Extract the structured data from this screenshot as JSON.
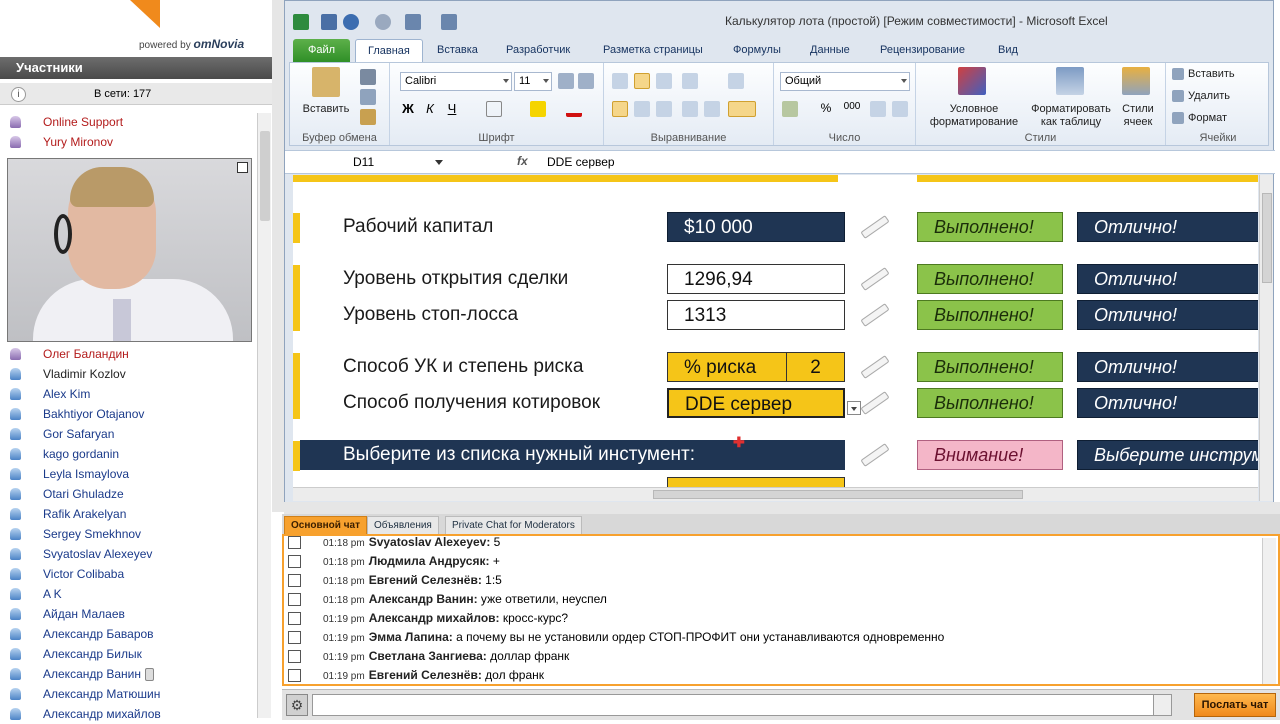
{
  "brand": {
    "powered": "powered by",
    "name": "omNovia"
  },
  "participants": {
    "header": "Участники",
    "online_label": "В сети: 177",
    "top_items": [
      "Online Support",
      "Yury Mironov"
    ],
    "items": [
      "Олег Баландин",
      "Vladimir Kozlov",
      "Alex Kim",
      "Bakhtiyor Otajanov",
      "Gor Safaryan",
      "kago gordanin",
      "Leyla Ismaylova",
      "Otari Ghuladze",
      "Rafik Arakelyan",
      "Sergey Smekhnov",
      "Svyatoslav Alexeyev",
      "Victor Colibaba",
      "A K",
      "Айдан Малаев",
      "Александр Баваров",
      "Александр Билык",
      "Александр Ванин",
      "Александр Матюшин",
      "Александр михайлов"
    ]
  },
  "excel": {
    "title": "Калькулятор лота (простой)  [Режим совместимости]  -  Microsoft Excel",
    "tabs": [
      "Файл",
      "Главная",
      "Вставка",
      "Разработчик",
      "Разметка страницы",
      "Формулы",
      "Данные",
      "Рецензирование",
      "Вид"
    ],
    "ribbon": {
      "paste": "Вставить",
      "clipboard": "Буфер обмена",
      "font_name": "Calibri",
      "font_size": "11",
      "font_group": "Шрифт",
      "align_group": "Выравнивание",
      "number_format": "Общий",
      "number_group": "Число",
      "cond_format": "Условное форматирование",
      "format_table": "Форматировать как таблицу",
      "cell_styles": "Стили ячеек",
      "styles_group": "Стили",
      "insert": "Вставить",
      "delete": "Удалить",
      "format": "Формат",
      "cells_group": "Ячейки"
    },
    "name_box": "D11",
    "fx": "fx",
    "formula": "DDE сервер",
    "sheet": {
      "capital_label": "Рабочий капитал",
      "capital_value": "$10 000",
      "open_label": "Уровень открытия сделки",
      "open_value": "1296,94",
      "stop_label": "Уровень стоп-лосса",
      "stop_value": "1313",
      "risk_label": "Способ УК и степень риска",
      "risk_mode": "% риска",
      "risk_value": "2",
      "quote_label": "Способ получения котировок",
      "quote_value": "DDE сервер",
      "instrument_label": "Выберите из списка нужный инстумент:",
      "done": "Выполнено!",
      "excellent": "Отлично!",
      "warning": "Внимание!",
      "choose": "Выберите инструмент"
    }
  },
  "chat": {
    "tabs": [
      "Основной чат",
      "Объявления",
      "Private Chat for Moderators"
    ],
    "messages": [
      {
        "time": "01:18 pm",
        "name": "Svyatoslav Alexeyev:",
        "text": " 5"
      },
      {
        "time": "01:18 pm",
        "name": "Людмила Андрусяк:",
        "text": " +"
      },
      {
        "time": "01:18 pm",
        "name": "Евгений Селезнёв:",
        "text": " 1:5"
      },
      {
        "time": "01:18 pm",
        "name": "Александр Ванин:",
        "text": " уже ответили, неуспел"
      },
      {
        "time": "01:19 pm",
        "name": "Александр михайлов:",
        "text": " кросс-курс?"
      },
      {
        "time": "01:19 pm",
        "name": "Эмма Лапина:",
        "text": " а почему вы не установили ордер СТОП-ПРОФИТ они устанавливаются одновременно"
      },
      {
        "time": "01:19 pm",
        "name": "Светлана Зангиева:",
        "text": " доллар франк"
      },
      {
        "time": "01:19 pm",
        "name": "Евгений Селезнёв:",
        "text": " дол франк"
      }
    ],
    "send": "Послать чат"
  }
}
